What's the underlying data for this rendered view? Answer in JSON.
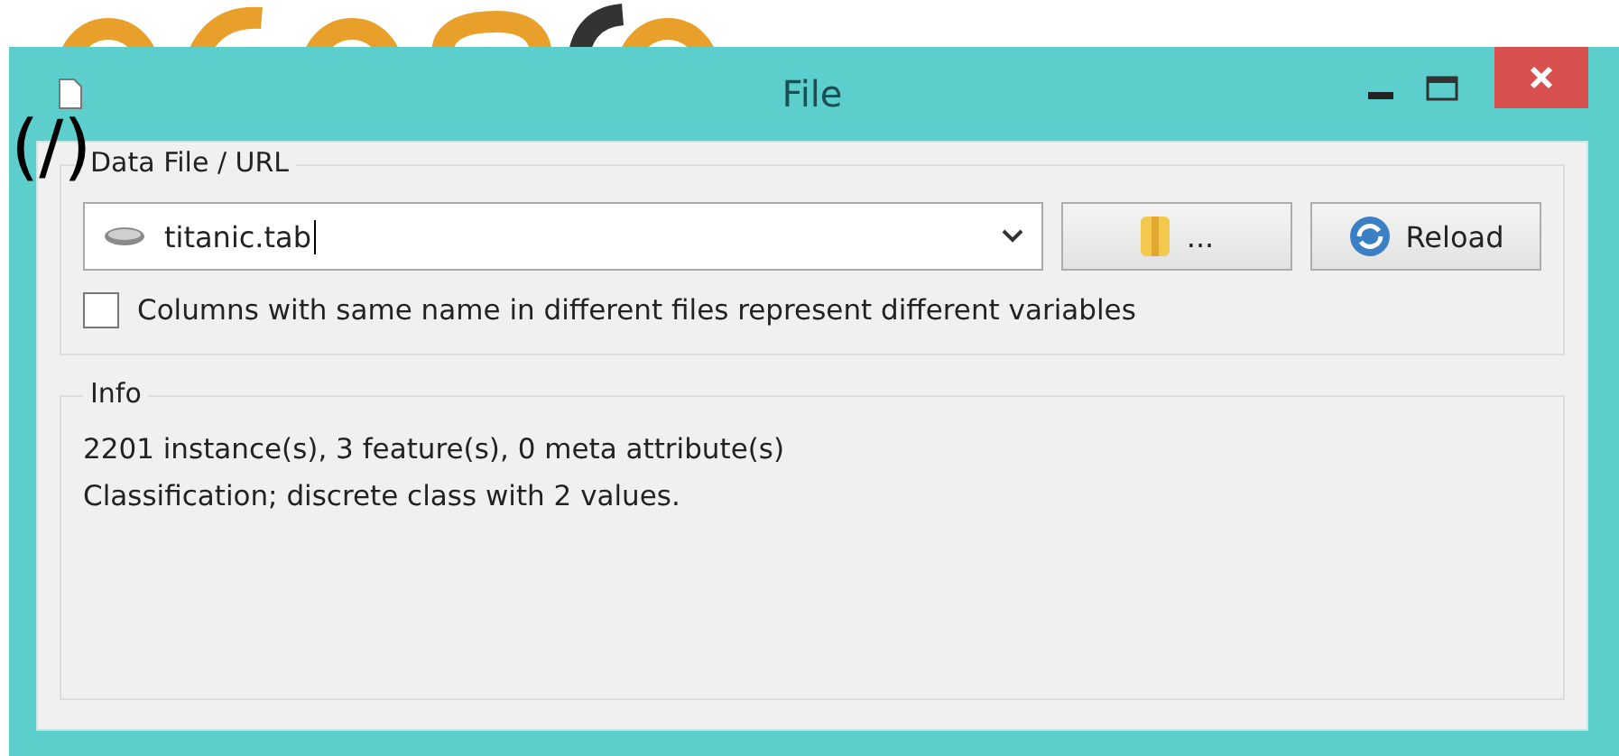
{
  "overlay_mark": "(/)",
  "window": {
    "title": "File"
  },
  "source": {
    "group_title": "Data File / URL",
    "file_value": "titanic.tab",
    "browse_label": "...",
    "reload_label": "Reload"
  },
  "options": [
    {
      "label": "Columns with same name in different files represent different variables",
      "checked": false
    }
  ],
  "info": {
    "group_title": "Info",
    "lines": [
      "2201 instance(s), 3 feature(s), 0 meta attribute(s)",
      "Classification; discrete class with 2 values."
    ]
  }
}
